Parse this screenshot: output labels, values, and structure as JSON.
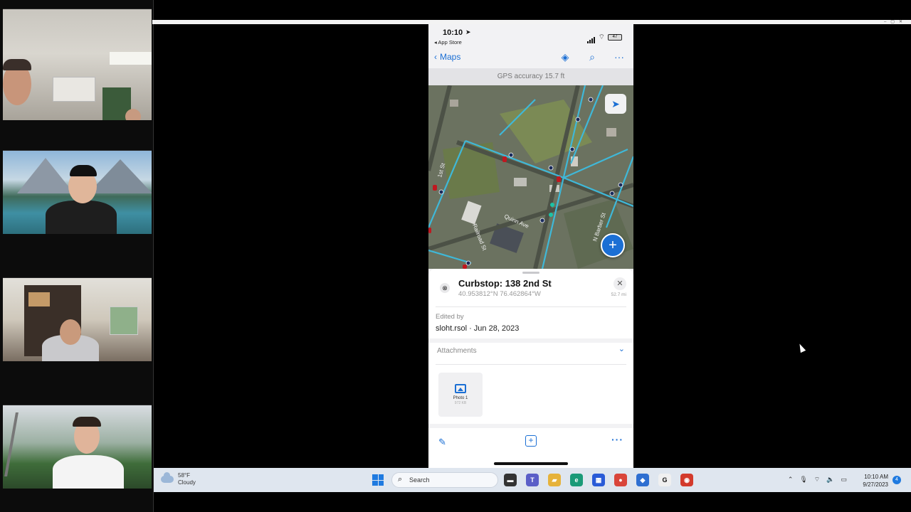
{
  "phone": {
    "status": {
      "time": "10:10",
      "back_app": "◂ App Store",
      "battery": "47"
    },
    "nav": {
      "back_label": "Maps",
      "icons": [
        "layers-icon",
        "search-icon",
        "more-icon"
      ]
    },
    "gps_accuracy": "GPS accuracy 15.7 ft",
    "map": {
      "street_labels": [
        "Quinn Ave",
        "Railroad St",
        "N Barber St",
        "1st St"
      ]
    },
    "feature": {
      "title": "Curbstop: 138 2nd St",
      "coords": "40.953812°N  76.462864°W",
      "distance": "52.7 mi",
      "edited_by_label": "Edited by",
      "edited_by_value": "sloht.rsol · Jun 28, 2023",
      "attachments_label": "Attachments",
      "attachment": {
        "name": "Photo 1",
        "size": "972 KB"
      }
    }
  },
  "taskbar": {
    "weather_temp": "58°F",
    "weather_desc": "Cloudy",
    "search_label": "Search",
    "apps": [
      {
        "name": "terminal-app",
        "color": "#333333",
        "glyph": "▬"
      },
      {
        "name": "teams-app",
        "color": "#5b5fc7",
        "glyph": "T"
      },
      {
        "name": "file-explorer-app",
        "color": "#e6b23a",
        "glyph": "▰"
      },
      {
        "name": "edge-app",
        "color": "#1a9a78",
        "glyph": "e"
      },
      {
        "name": "store-app",
        "color": "#2a5bd7",
        "glyph": "▦"
      },
      {
        "name": "chrome-app",
        "color": "#d9453a",
        "glyph": "●"
      },
      {
        "name": "security-app",
        "color": "#2f6fd1",
        "glyph": "◆"
      },
      {
        "name": "g-app",
        "color": "#f0f0f0",
        "glyph": "G"
      },
      {
        "name": "meeting-app",
        "color": "#d33a2c",
        "glyph": "◉"
      }
    ],
    "time": "10:10 AM",
    "date": "9/27/2023",
    "notifications": "4"
  },
  "colors": {
    "accent": "#1b6fd4",
    "pipe": "#3fb8d8",
    "hydrant": "#c0171f"
  }
}
